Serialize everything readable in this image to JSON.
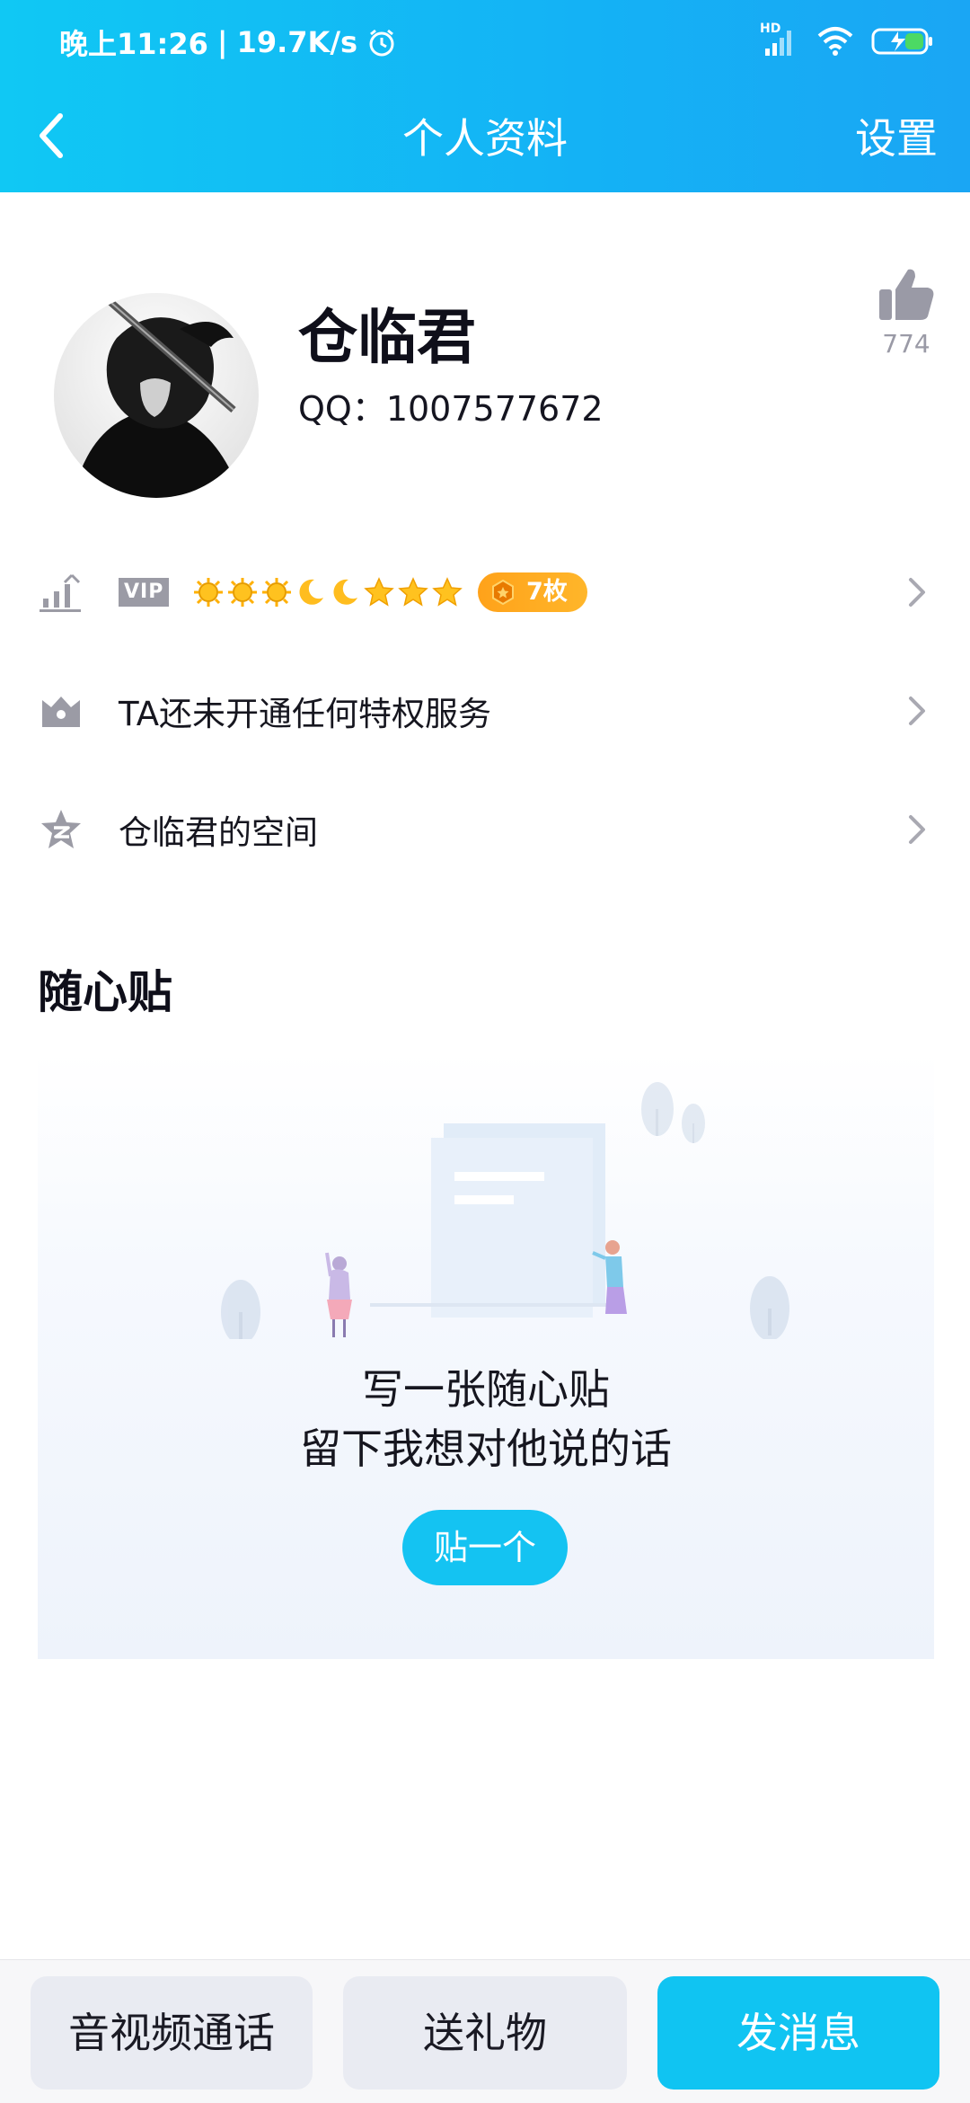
{
  "status_bar": {
    "time": "晚上11:26",
    "net_speed": "19.7K/s",
    "network_label": "HD"
  },
  "nav": {
    "title": "个人资料",
    "settings_label": "设置"
  },
  "profile": {
    "name": "仓临君",
    "qq": "QQ：1007577672",
    "like_count": "774"
  },
  "level_row": {
    "vip_label": "VIP",
    "level_icons": [
      "sun",
      "sun",
      "sun",
      "moon",
      "moon",
      "star",
      "star",
      "star"
    ],
    "medal_label": "7枚"
  },
  "privilege_row": {
    "label": "TA还未开通任何特权服务"
  },
  "space_row": {
    "label": "仓临君的空间"
  },
  "note_section": {
    "title": "随心贴",
    "line1": "写一张随心贴",
    "line2": "留下我想对他说的话",
    "button": "贴一个"
  },
  "bottom_bar": {
    "call_label": "音视频通话",
    "gift_label": "送礼物",
    "message_label": "发消息"
  },
  "colors": {
    "brand_blue": "#14b8f4",
    "medal_orange": "#ffa21a",
    "icon_gray": "#9b9ba5"
  }
}
